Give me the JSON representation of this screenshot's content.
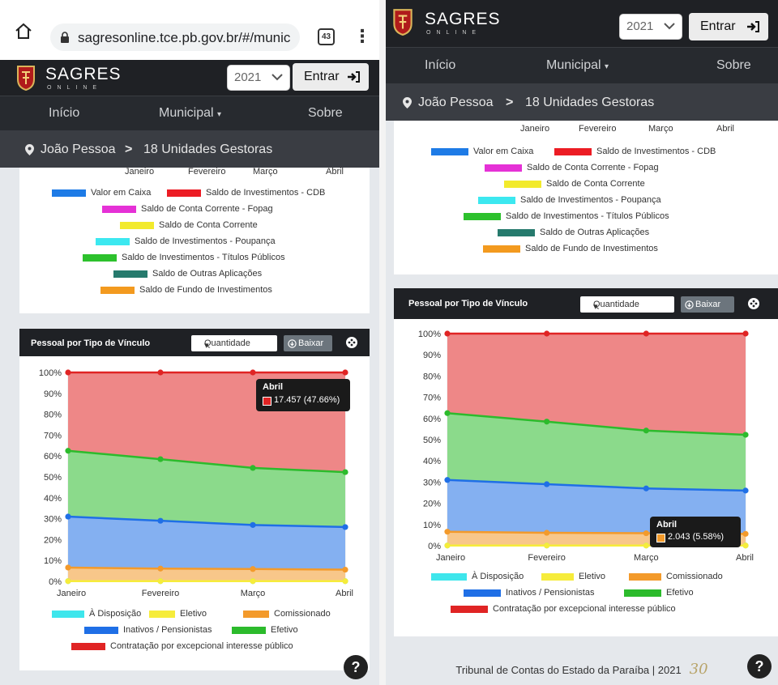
{
  "browser": {
    "url": "sagresonline.tce.pb.gov.br/#/munic",
    "tab_count": "43"
  },
  "nav": {
    "brand": "SAGRES",
    "brand_sub": "ONLINE",
    "year": "2021",
    "login_label": "Entrar",
    "menu": [
      "Início",
      "Municipal",
      "Sobre"
    ]
  },
  "breadcrumb": {
    "municipality": "João Pessoa",
    "separator": ">",
    "units": "18 Unidades Gestoras"
  },
  "balance_chart": {
    "months": [
      "Janeiro",
      "Fevereiro",
      "Março",
      "Abril"
    ],
    "legend": [
      {
        "label": "Valor em Caixa",
        "color": "#1e7be6"
      },
      {
        "label": "Saldo de Investimentos - CDB",
        "color": "#ec1c24"
      },
      {
        "label": "Saldo de Conta Corrente - Fopag",
        "color": "#e531d6"
      },
      {
        "label": "Saldo de Conta Corrente",
        "color": "#f2ea2c"
      },
      {
        "label": "Saldo de Investimentos - Poupança",
        "color": "#3ce8f0"
      },
      {
        "label": "Saldo de Investimentos - Títulos Públicos",
        "color": "#2dc12d"
      },
      {
        "label": "Saldo de Outras Aplicações",
        "color": "#267a6d"
      },
      {
        "label": "Saldo de Fundo de Investimentos",
        "color": "#f39a1f"
      }
    ]
  },
  "pessoal_card": {
    "title": "Pessoal por Tipo de Vínculo",
    "select_value": "Quantidade",
    "download_label": "Baixar"
  },
  "chart_data": {
    "type": "area",
    "title": "",
    "x": [
      "Janeiro",
      "Fevereiro",
      "Março",
      "Abril"
    ],
    "ylim": [
      0,
      100
    ],
    "yticks": [
      "0%",
      "10%",
      "20%",
      "30%",
      "40%",
      "50%",
      "60%",
      "70%",
      "80%",
      "90%",
      "100%"
    ],
    "stacked_percent": true,
    "legend_position": "bottom",
    "series": [
      {
        "name": "À Disposição",
        "color": "#3ee6ec",
        "cumulative": [
          0.1,
          0.1,
          0.1,
          0.1
        ]
      },
      {
        "name": "Eletivo",
        "color": "#f6ec3b",
        "cumulative": [
          0.1,
          0.1,
          0.1,
          0.1
        ]
      },
      {
        "name": "Comissionado",
        "color": "#f39a2b",
        "cumulative": [
          6.6,
          6.1,
          5.9,
          5.6
        ]
      },
      {
        "name": "Inativos / Pensionistas",
        "color": "#1f6fe6",
        "cumulative": [
          31,
          29,
          27,
          26
        ]
      },
      {
        "name": "Efetivo",
        "color": "#2cbb2c",
        "cumulative": [
          62.5,
          58.5,
          54.3,
          52.3
        ]
      },
      {
        "name": "Contratação por excepcional interesse público",
        "color": "#e02424",
        "cumulative": [
          100,
          100,
          100,
          100
        ]
      }
    ]
  },
  "tooltips": {
    "left": {
      "month": "Abril",
      "value": "17.457 (47.66%)",
      "color": "#e02424"
    },
    "right": {
      "month": "Abril",
      "value": "2.043 (5.58%)",
      "color": "#f39a2b"
    }
  },
  "footer": {
    "text": "Tribunal de Contas do Estado da Paraíba | 2021",
    "logo_text": "30"
  },
  "help_label": "?"
}
